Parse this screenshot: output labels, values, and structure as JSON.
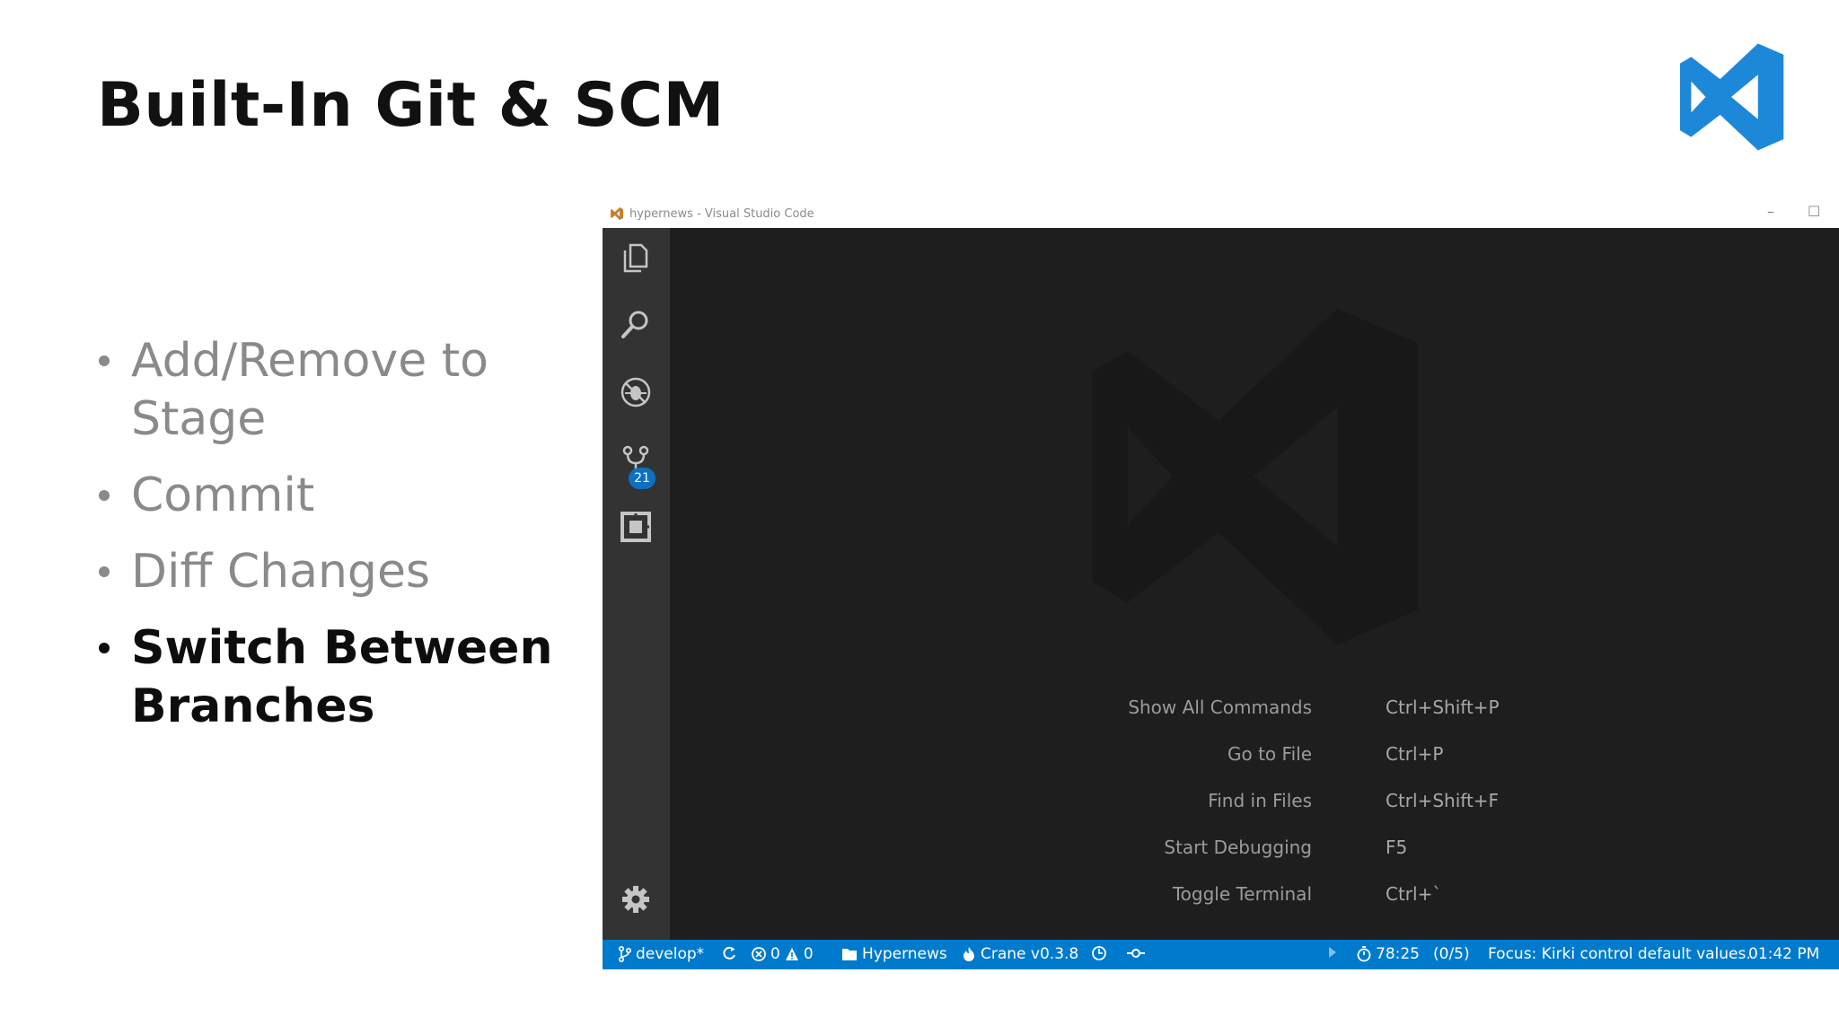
{
  "slide": {
    "title": "Built-In Git & SCM",
    "bullets": [
      {
        "text": "Add/Remove to Stage",
        "active": false
      },
      {
        "text": "Commit",
        "active": false
      },
      {
        "text": "Diff Changes",
        "active": false
      },
      {
        "text": "Switch Between Branches",
        "active": true
      }
    ]
  },
  "window": {
    "title": "hypernews - Visual Studio Code",
    "controls": {
      "minimize": "–",
      "maximize": "☐"
    }
  },
  "activity_bar": {
    "items": [
      {
        "name": "explorer-icon"
      },
      {
        "name": "search-icon"
      },
      {
        "name": "debug-icon"
      },
      {
        "name": "source-control-icon",
        "badge": "21"
      },
      {
        "name": "extensions-icon"
      },
      {
        "name": "settings-gear-icon"
      }
    ]
  },
  "shortcuts": [
    {
      "command": "Show All Commands",
      "key": "Ctrl+Shift+P"
    },
    {
      "command": "Go to File",
      "key": "Ctrl+P"
    },
    {
      "command": "Find in Files",
      "key": "Ctrl+Shift+F"
    },
    {
      "command": "Start Debugging",
      "key": "F5"
    },
    {
      "command": "Toggle Terminal",
      "key": "Ctrl+`"
    }
  ],
  "statusbar": {
    "branch": "develop*",
    "errors": "0",
    "warnings": "0",
    "folder": "Hypernews",
    "crane": "Crane v0.3.8",
    "timer": "78:25",
    "progress": "(0/5)",
    "focus": "Focus: Kirki control default values.",
    "time": "01:42 PM"
  },
  "colors": {
    "statusbar": "#007acc",
    "activitybar": "#333333",
    "editor": "#1e1e1e",
    "vs_logo": "#1e88d8"
  }
}
